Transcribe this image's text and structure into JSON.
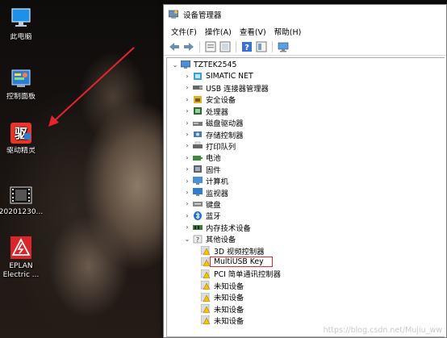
{
  "desktop": {
    "icons": [
      {
        "label": "此电脑",
        "icon": "computer-icon"
      },
      {
        "label": "控制面板",
        "icon": "control-panel-icon"
      },
      {
        "label": "驱动精灵",
        "icon": "driver-genius-icon"
      },
      {
        "label": "20201230...",
        "icon": "video-file-icon"
      },
      {
        "label_line1": "EPLAN",
        "label_line2": "Electric ...",
        "icon": "eplan-icon"
      }
    ],
    "arrow_color": "#e4252c"
  },
  "window": {
    "title": "设备管理器",
    "menu": [
      "文件(F)",
      "操作(A)",
      "查看(V)",
      "帮助(H)"
    ],
    "toolbar_icons": [
      "back-arrow-icon",
      "forward-arrow-icon",
      "properties-icon",
      "update-driver-icon",
      "help-icon",
      "show-hidden-icon",
      "monitor-scan-icon"
    ],
    "tree": {
      "root": "TZTEK2545",
      "categories": [
        {
          "label": "SIMATIC NET",
          "icon": "network-icon",
          "expanded": false
        },
        {
          "label": "USB 连接器管理器",
          "icon": "usb-icon",
          "expanded": false
        },
        {
          "label": "安全设备",
          "icon": "security-icon",
          "expanded": false
        },
        {
          "label": "处理器",
          "icon": "cpu-icon",
          "expanded": false
        },
        {
          "label": "磁盘驱动器",
          "icon": "disk-icon",
          "expanded": false
        },
        {
          "label": "存储控制器",
          "icon": "storage-icon",
          "expanded": false
        },
        {
          "label": "打印队列",
          "icon": "printer-icon",
          "expanded": false
        },
        {
          "label": "电池",
          "icon": "battery-icon",
          "expanded": false
        },
        {
          "label": "固件",
          "icon": "firmware-icon",
          "expanded": false
        },
        {
          "label": "计算机",
          "icon": "computer-icon",
          "expanded": false
        },
        {
          "label": "监视器",
          "icon": "monitor-icon",
          "expanded": false
        },
        {
          "label": "键盘",
          "icon": "keyboard-icon",
          "expanded": false
        },
        {
          "label": "蓝牙",
          "icon": "bluetooth-icon",
          "expanded": false
        },
        {
          "label": "内存技术设备",
          "icon": "memory-icon",
          "expanded": false
        },
        {
          "label": "其他设备",
          "icon": "other-devices-icon",
          "expanded": true
        }
      ],
      "other_devices": [
        {
          "label": "3D 视频控制器",
          "icon": "warning-device-icon"
        },
        {
          "label": "MultiUSB Key",
          "icon": "warning-device-icon",
          "highlighted": true
        },
        {
          "label": "PCI 简单通讯控制器",
          "icon": "warning-device-icon"
        },
        {
          "label": "未知设备",
          "icon": "warning-device-icon"
        },
        {
          "label": "未知设备",
          "icon": "warning-device-icon"
        },
        {
          "label": "未知设备",
          "icon": "warning-device-icon"
        },
        {
          "label": "未知设备",
          "icon": "warning-device-icon"
        }
      ]
    },
    "highlight_color": "#e4252c"
  },
  "watermark": "https://blog.csdn.net/Mujiu_ww"
}
